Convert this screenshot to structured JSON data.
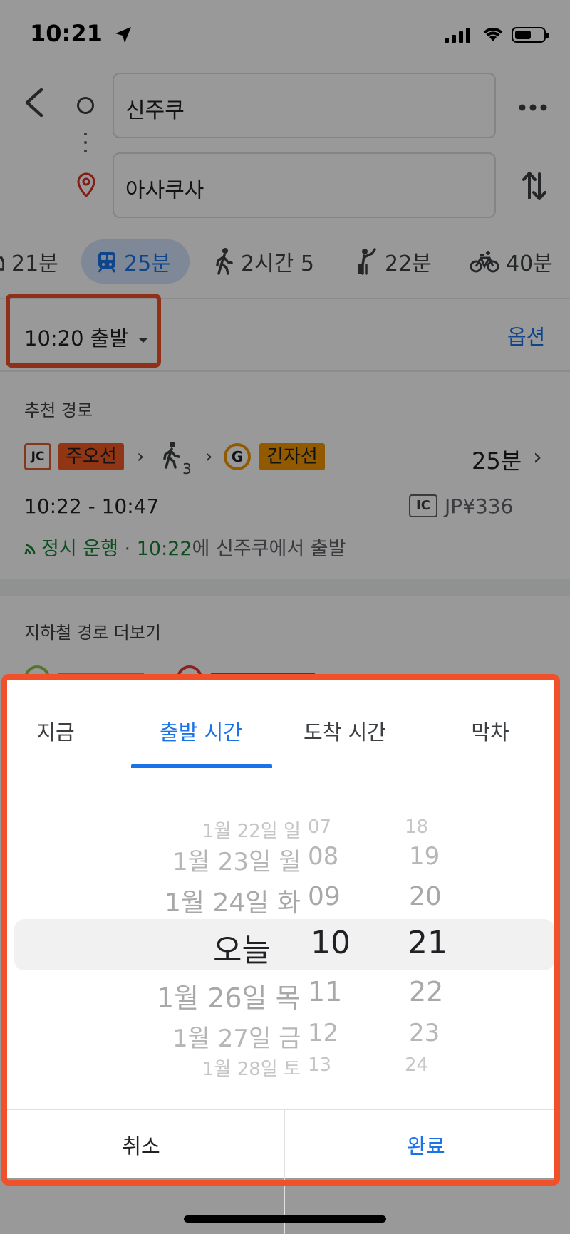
{
  "status_bar": {
    "time": "10:21"
  },
  "search": {
    "origin": "신주쿠",
    "destination": "아사쿠사"
  },
  "modes": [
    {
      "label": "21분"
    },
    {
      "label": "25분"
    },
    {
      "label": "2시간 5"
    },
    {
      "label": "22분"
    },
    {
      "label": "40분"
    }
  ],
  "depart_label": "10:20 출발",
  "options_label": "옵션",
  "recommended": {
    "heading": "추천 경로",
    "jc_badge": "JC",
    "line1": "주오선",
    "walk_minutes": "3",
    "g_badge": "G",
    "line2": "긴자선",
    "duration": "25분",
    "times": "10:22 - 10:47",
    "ic_badge": "IC",
    "fare": "JP¥336",
    "status_on_time": "정시 운행",
    "status_sep": "·",
    "status_time": "10:22",
    "status_suffix": "에 신주쿠에서 출발"
  },
  "more_routes_label": "지하철 경로 더보기",
  "sheet": {
    "tabs": [
      "지금",
      "출발 시간",
      "도착 시간",
      "막차"
    ],
    "active_tab": "출발 시간",
    "dates": [
      "1월 22일 일",
      "1월 23일 월",
      "1월 24일 화",
      "오늘",
      "1월 26일 목",
      "1월 27일 금",
      "1월 28일 토"
    ],
    "hours": [
      "07",
      "08",
      "09",
      "10",
      "11",
      "12",
      "13"
    ],
    "minutes": [
      "18",
      "19",
      "20",
      "21",
      "22",
      "23",
      "24"
    ],
    "selected": {
      "date": "오늘",
      "hour": "10",
      "minute": "21"
    },
    "cancel": "취소",
    "done": "완료"
  },
  "colors": {
    "accent": "#1a73e8",
    "annotation": "#f0512a",
    "chuo_line": "#f05a22",
    "ginza_line": "#f39700",
    "on_time": "#188038"
  }
}
